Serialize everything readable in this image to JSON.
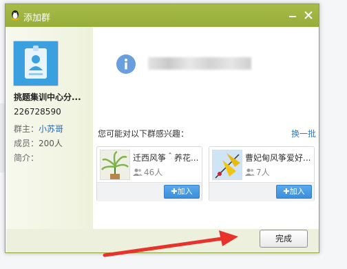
{
  "window": {
    "title": "添加群"
  },
  "group": {
    "name": "挑题集训中心分...",
    "id": "226728590",
    "owner_label": "群主：",
    "owner": "小苏哥",
    "members_label": "成员：",
    "members": "200人",
    "intro_label": "简介："
  },
  "suggest": {
    "label": "您可能对以下群感兴趣：",
    "refresh": "换一批",
    "cards": [
      {
        "name": "迁西风筝＾养花...",
        "count": "46人",
        "join": "✚加入"
      },
      {
        "name": "曹妃甸风筝爱好...",
        "count": "7人",
        "join": "✚加入"
      }
    ]
  },
  "footer": {
    "finish": "完成"
  },
  "colors": {
    "titlebar": "#a6bb49",
    "link": "#2a7bd1",
    "join": "#3b8edb",
    "arrow": "#e8322c"
  }
}
